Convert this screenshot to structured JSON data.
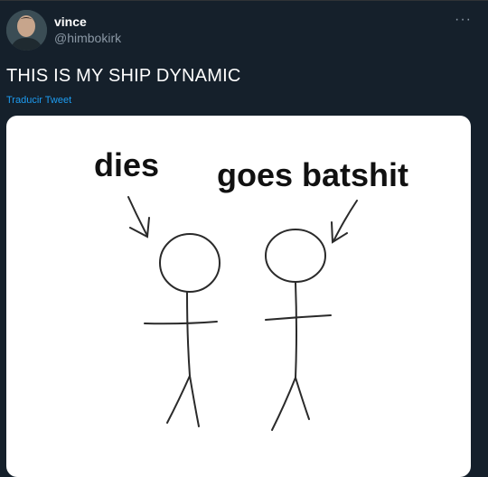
{
  "tweet": {
    "display_name": "vince",
    "handle": "@himbokirk",
    "more_label": "···",
    "text": "THIS IS MY SHIP DYNAMIC",
    "translate_link": "Traducir Tweet",
    "avatar": {
      "icon": "user-avatar"
    }
  },
  "media": {
    "label_left": "dies",
    "label_right": "goes batshit"
  },
  "colors": {
    "background": "#15202b",
    "text": "#ffffff",
    "muted": "#8b98a5",
    "link": "#1d9bf0"
  }
}
